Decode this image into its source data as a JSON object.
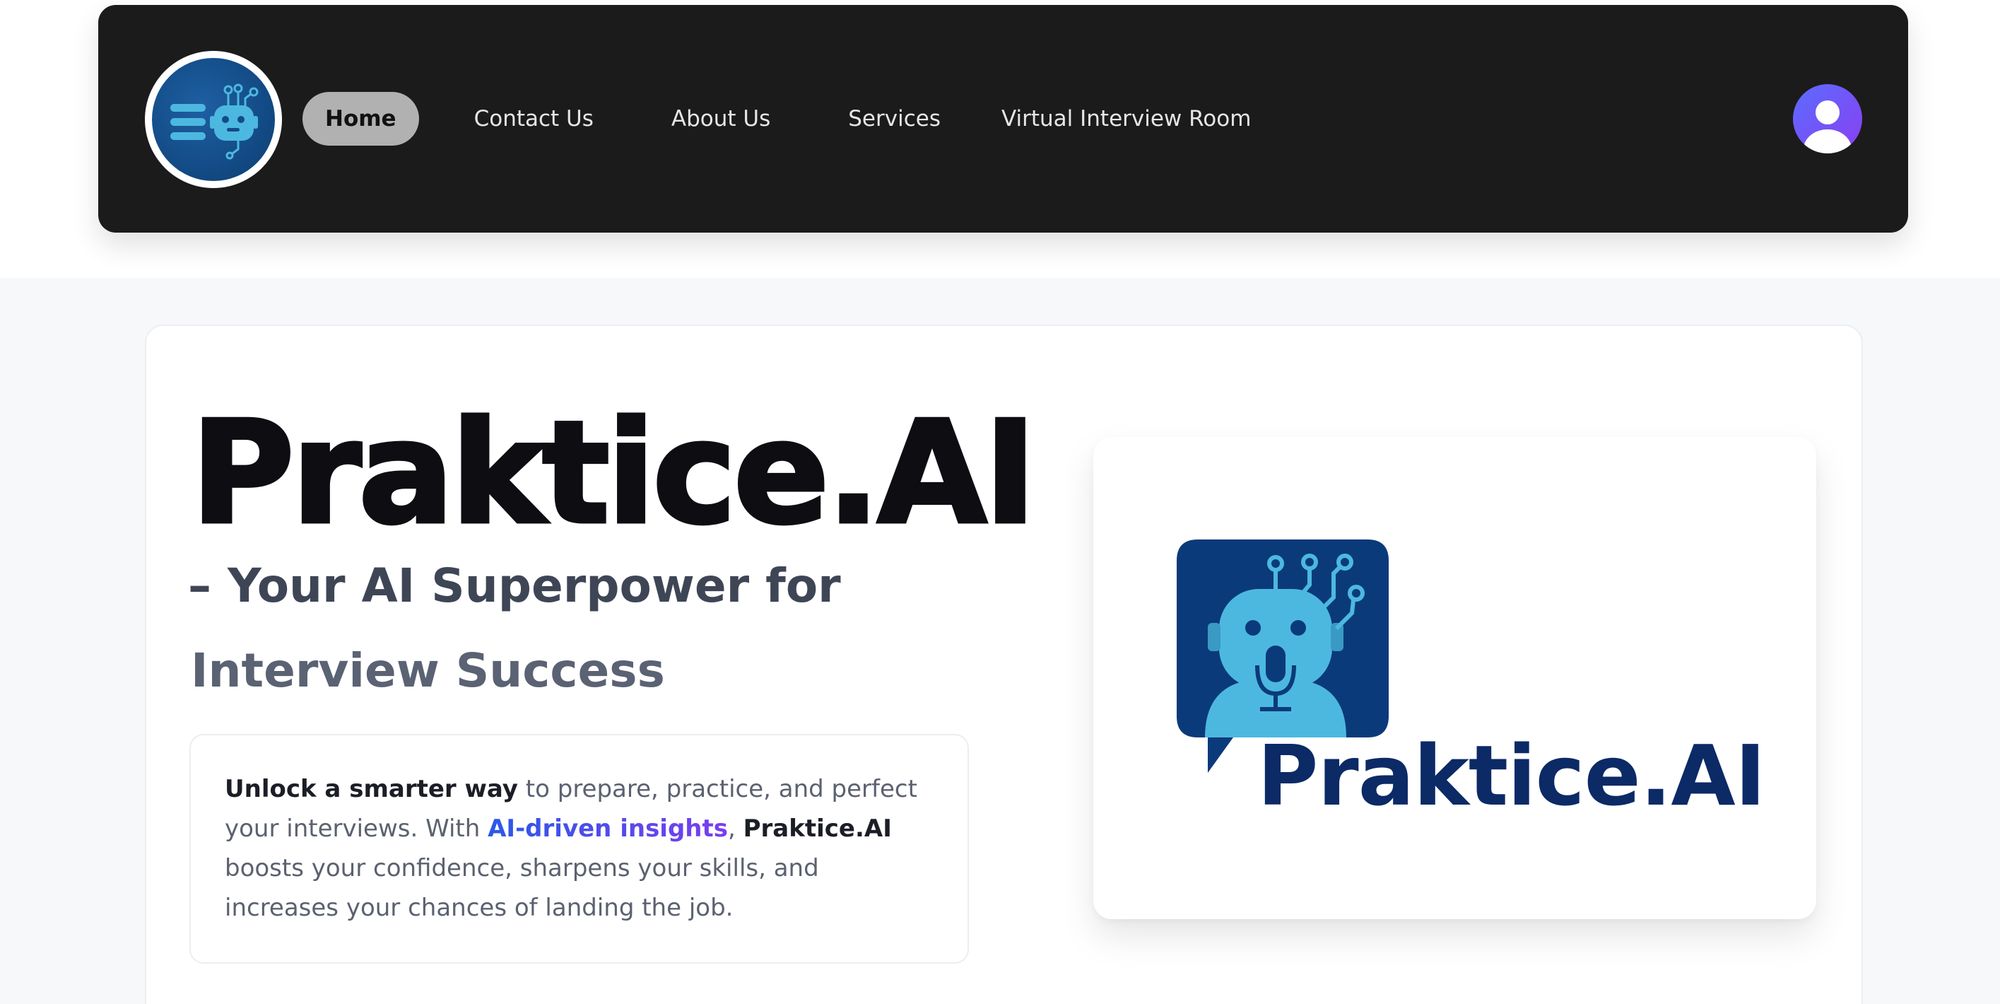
{
  "navbar": {
    "logo_icon": "robot-menu-logo",
    "items": [
      {
        "label": "Home",
        "active": true
      },
      {
        "label": "Contact Us",
        "active": false
      },
      {
        "label": "About Us",
        "active": false
      },
      {
        "label": "Services",
        "active": false
      },
      {
        "label": "Virtual Interview Room",
        "active": false
      }
    ],
    "avatar_icon": "user-icon"
  },
  "hero": {
    "title": "Praktice.AI",
    "subtitle_line1": "– Your AI Superpower for",
    "subtitle_line2": "Interview Success",
    "description": {
      "part1": "Unlock a smarter way",
      "part2": " to prepare, practice, and perfect your interviews. With ",
      "part3": "AI-driven insights",
      "part4": ", ",
      "part5": "Praktice.AI",
      "part6": " boosts your confidence, sharpens your skills, and increases your chances of landing the job."
    },
    "image": {
      "icon": "robot-microphone-icon",
      "brand_text": "Praktice.AI"
    }
  },
  "colors": {
    "navbar_bg": "#1b1b1b",
    "active_pill": "#b1b1b1",
    "brand_navy": "#0b2a66",
    "robot_blue": "#4cb8e0",
    "accent_start": "#2b59e6",
    "accent_end": "#7a3df0"
  }
}
